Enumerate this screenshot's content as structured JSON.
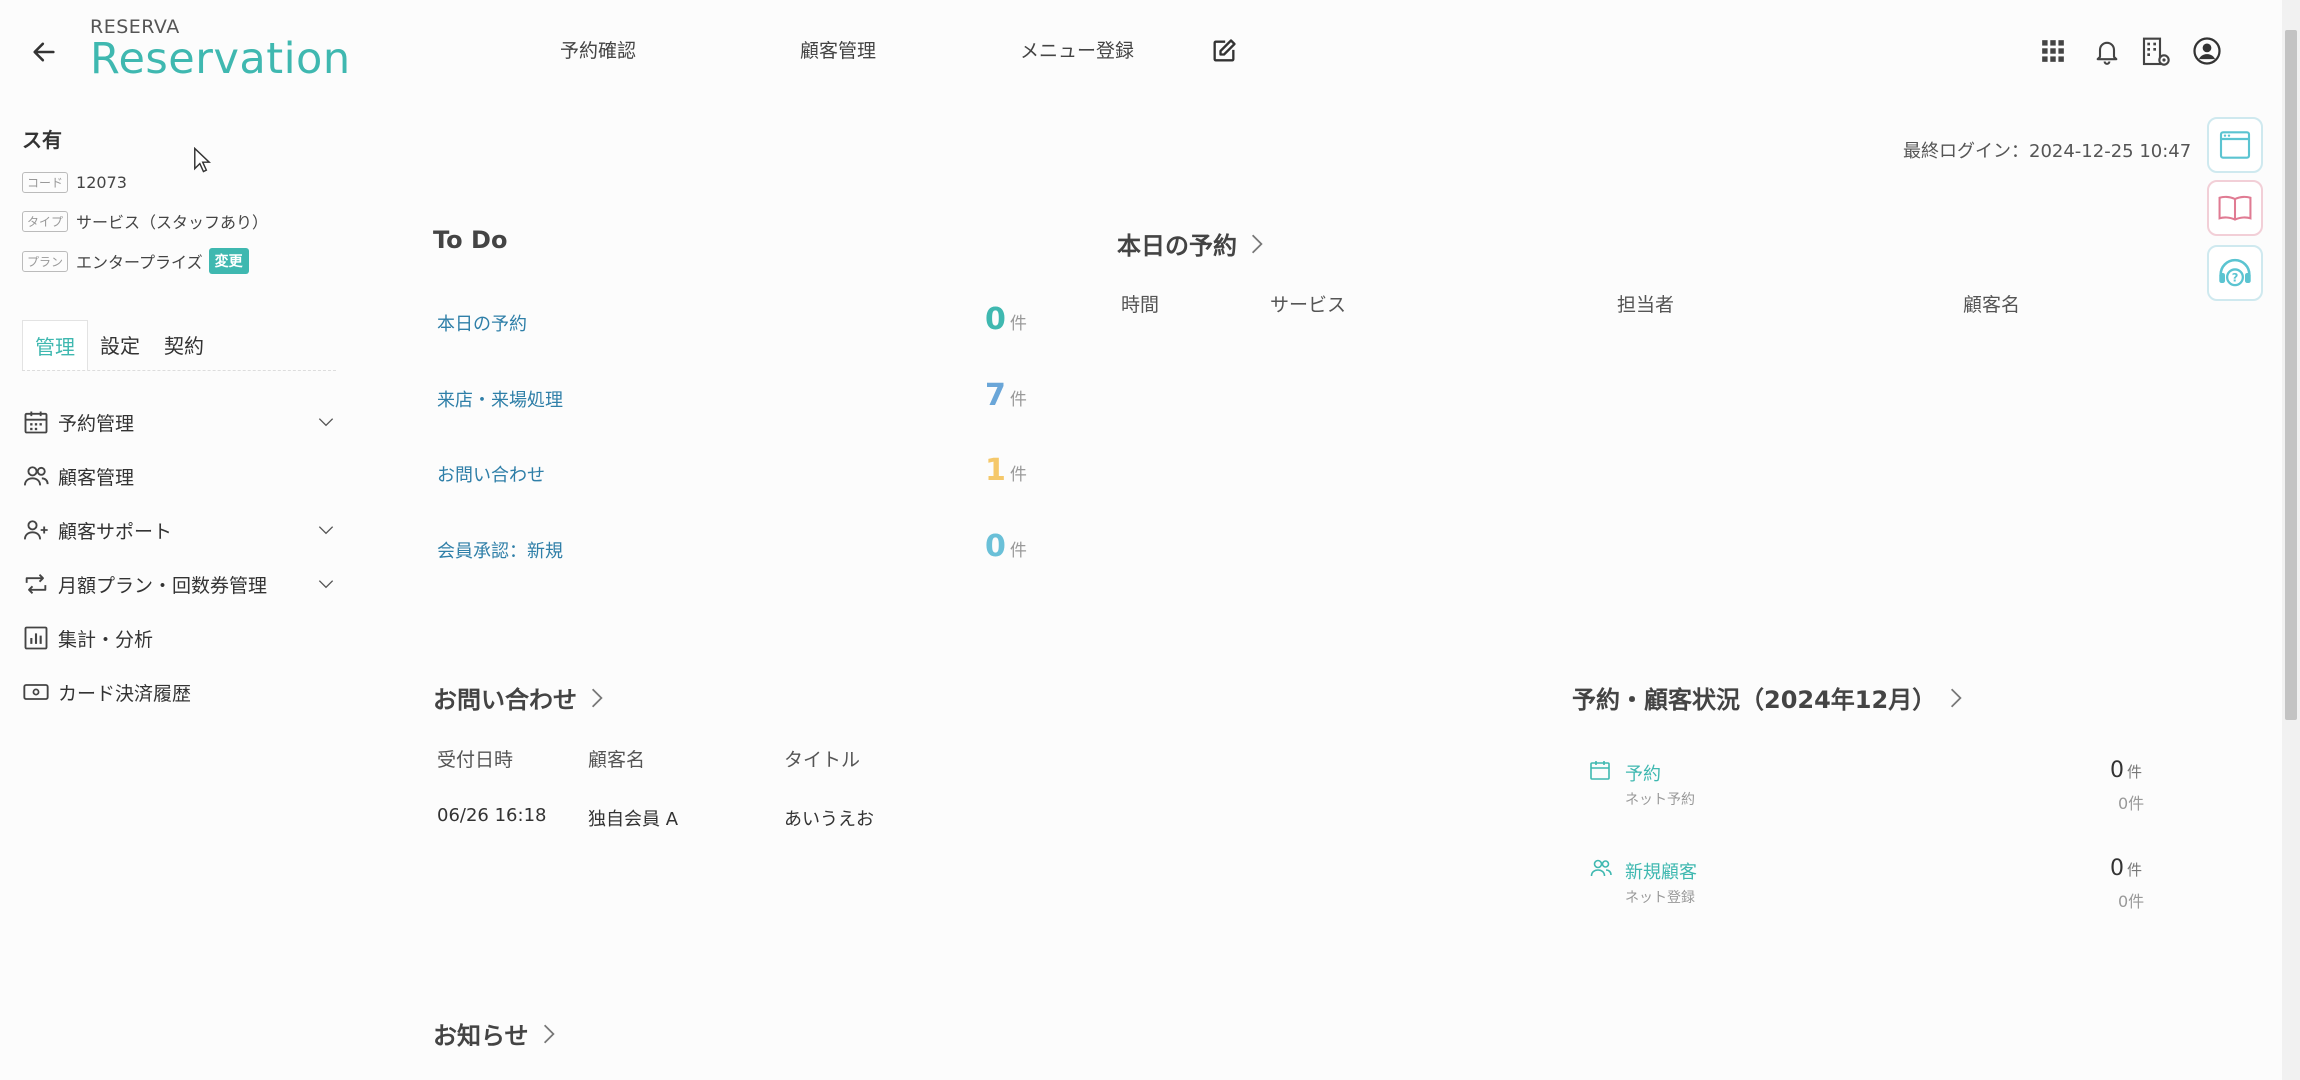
{
  "header": {
    "brand_top": "RESERVA",
    "brand_main": "Reservation",
    "nav": [
      "予約確認",
      "顧客管理",
      "メニュー登録"
    ],
    "icons": [
      "back-arrow-icon",
      "edit-icon",
      "apps-grid-icon",
      "bell-icon",
      "building-gear-icon",
      "user-circle-icon"
    ]
  },
  "sidebar": {
    "name": "ス有",
    "code_tag": "コード",
    "code_value": "12073",
    "type_tag": "タイプ",
    "type_value": "サービス（スタッフあり）",
    "plan_tag": "プラン",
    "plan_value": "エンタープライズ",
    "change_label": "変更",
    "tabs": [
      "管理",
      "設定",
      "契約"
    ],
    "menu": [
      {
        "label": "予約管理",
        "icon": "calendar-icon",
        "expandable": true
      },
      {
        "label": "顧客管理",
        "icon": "users-icon",
        "expandable": false
      },
      {
        "label": "顧客サポート",
        "icon": "user-plus-icon",
        "expandable": true
      },
      {
        "label": "月額プラン・回数券管理",
        "icon": "repeat-icon",
        "expandable": true
      },
      {
        "label": "集計・分析",
        "icon": "chart-icon",
        "expandable": false
      },
      {
        "label": "カード決済履歴",
        "icon": "card-icon",
        "expandable": false
      }
    ]
  },
  "last_login": "最終ログイン：2024-12-25 10:47",
  "todo": {
    "title": "To Do",
    "unit": "件",
    "items": [
      {
        "label": "本日の予約",
        "count": "0",
        "color": "#3fb8b0"
      },
      {
        "label": "来店・来場処理",
        "count": "7",
        "color": "#6aa6d8"
      },
      {
        "label": "お問い合わせ",
        "count": "1",
        "color": "#f5c86a"
      },
      {
        "label": "会員承認：新規",
        "count": "0",
        "color": "#6ac0d8"
      }
    ]
  },
  "today": {
    "title": "本日の予約",
    "columns": [
      "時間",
      "サービス",
      "担当者",
      "顧客名"
    ]
  },
  "inquiries": {
    "title": "お問い合わせ",
    "columns": [
      "受付日時",
      "顧客名",
      "タイトル"
    ],
    "rows": [
      {
        "date": "06/26 16:18",
        "customer": "独自会員 A",
        "title": "あいうえお"
      }
    ]
  },
  "status": {
    "title": "予約・顧客状況（2024年12月）",
    "unit": "件",
    "items": [
      {
        "label": "予約",
        "sub": "ネット予約",
        "value": "0",
        "sub_value": "0件"
      },
      {
        "label": "新規顧客",
        "sub": "ネット登録",
        "value": "0",
        "sub_value": "0件"
      }
    ]
  },
  "news": {
    "title": "お知らせ"
  }
}
